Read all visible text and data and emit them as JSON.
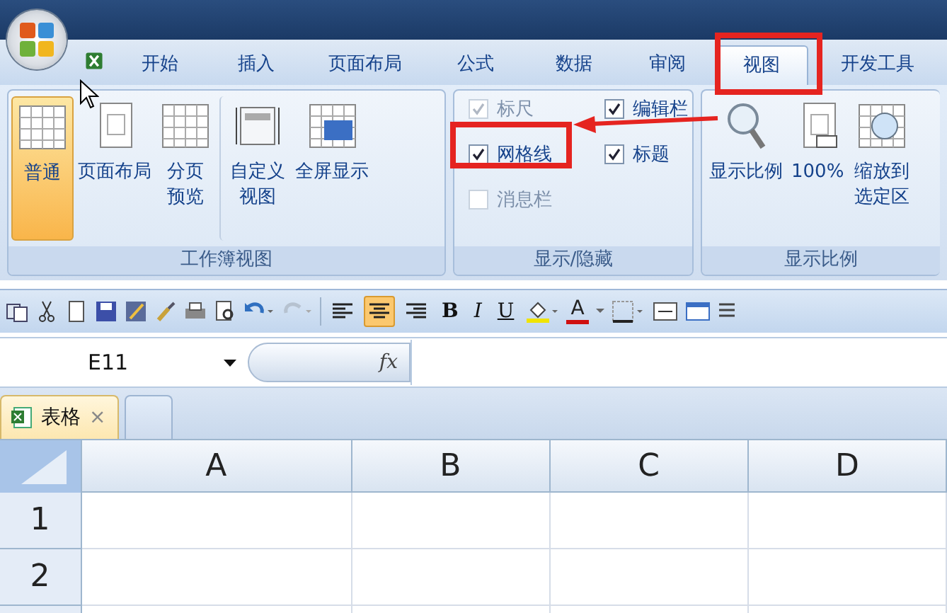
{
  "tabs": [
    {
      "label": "开始",
      "selected": false
    },
    {
      "label": "插入",
      "selected": false
    },
    {
      "label": "页面布局",
      "selected": false
    },
    {
      "label": "公式",
      "selected": false
    },
    {
      "label": "数据",
      "selected": false
    },
    {
      "label": "审阅",
      "selected": false
    },
    {
      "label": "视图",
      "selected": true
    },
    {
      "label": "开发工具",
      "selected": false
    }
  ],
  "ribbon": {
    "groups": [
      {
        "kind": "buttons",
        "title": "工作簿视图",
        "buttons": [
          {
            "label": "普通",
            "selected": true
          },
          {
            "label": "页面布局",
            "selected": false
          },
          {
            "label": "分页预览",
            "selected": false
          },
          {
            "label": "自定义视图",
            "selected": false
          },
          {
            "label": "全屏显示",
            "selected": false
          }
        ]
      },
      {
        "kind": "checks",
        "title": "显示/隐藏",
        "checks": [
          {
            "label": "标尺",
            "checked": true,
            "disabled": true
          },
          {
            "label": "编辑栏",
            "checked": true,
            "disabled": false
          },
          {
            "label": "网格线",
            "checked": true,
            "disabled": false
          },
          {
            "label": "标题",
            "checked": true,
            "disabled": false
          },
          {
            "label": "消息栏",
            "checked": false,
            "disabled": true
          }
        ]
      },
      {
        "kind": "buttons",
        "title": "显示比例",
        "buttons": [
          {
            "label": "显示比例",
            "selected": false
          },
          {
            "label": "100%",
            "selected": false
          },
          {
            "label": "缩放到选定区",
            "selected": false
          }
        ]
      }
    ]
  },
  "toolbar": {
    "align": [
      {
        "selected": false
      },
      {
        "selected": true
      },
      {
        "selected": false
      }
    ],
    "bold": "B",
    "italic": "I",
    "underline": "U",
    "font_color": "A"
  },
  "formula_bar": {
    "name_box": "E11",
    "fx": "fx"
  },
  "sheet_tabs": [
    {
      "label": "表格",
      "close": "×"
    }
  ],
  "grid": {
    "columns": [
      "A",
      "B",
      "C",
      "D"
    ],
    "rows": [
      "1",
      "2"
    ]
  }
}
